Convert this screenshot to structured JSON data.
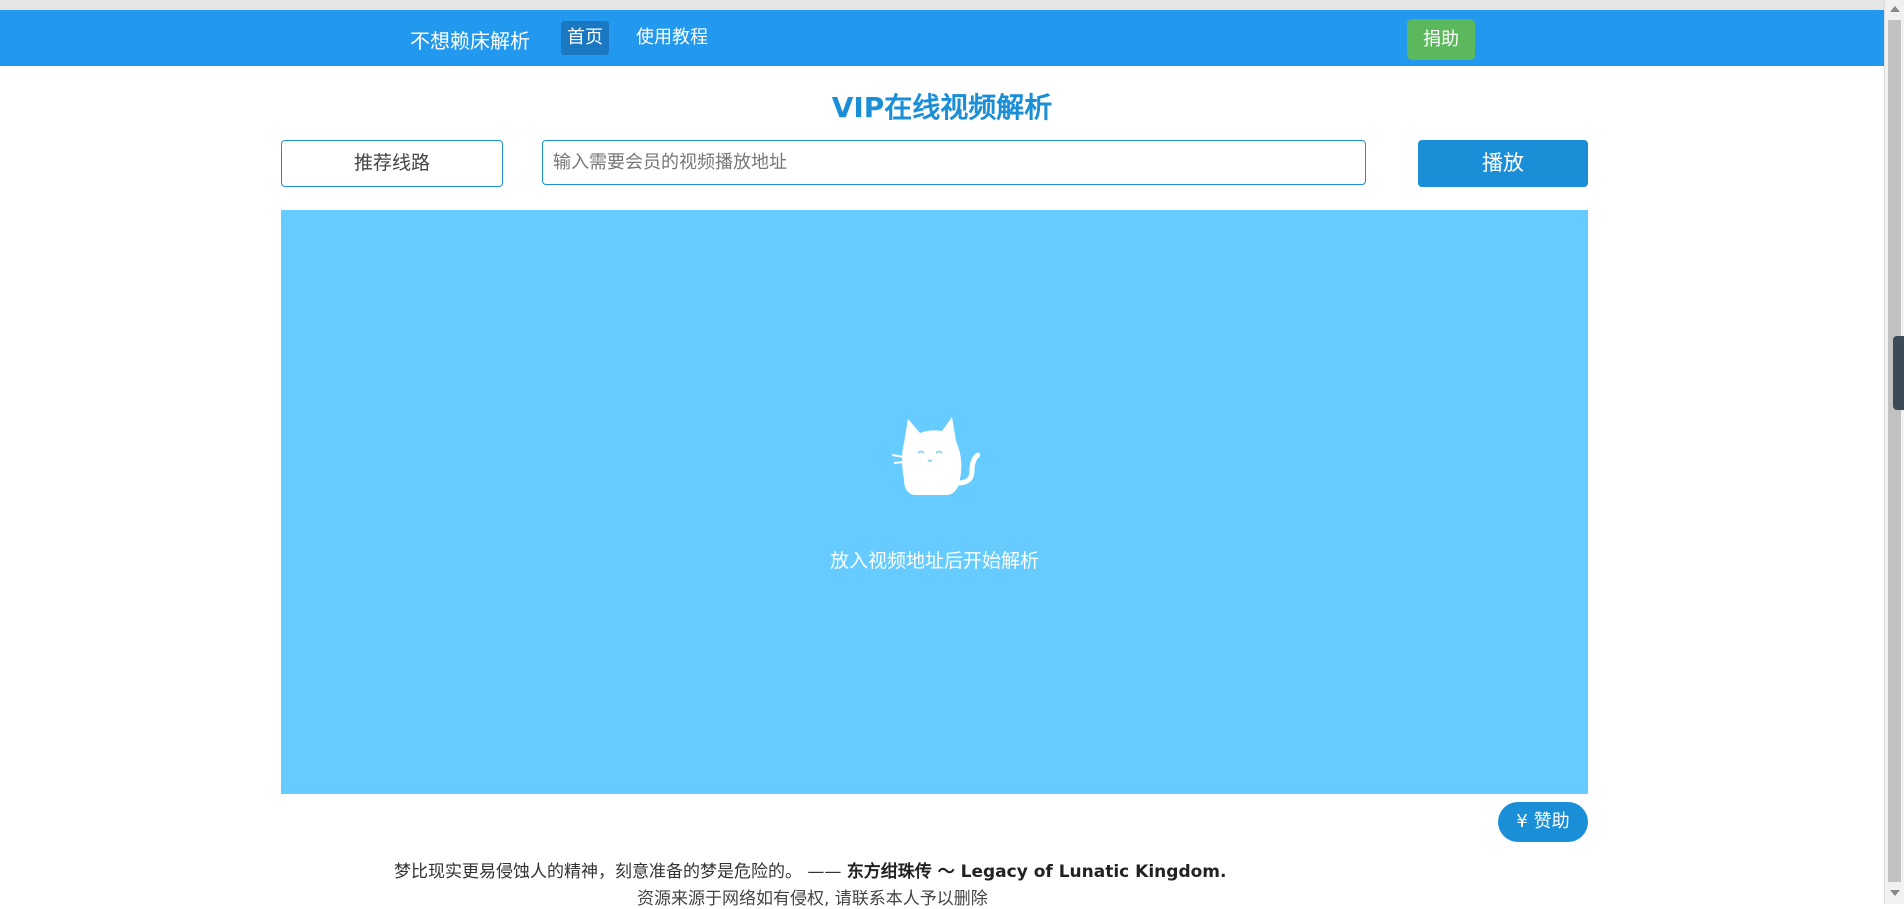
{
  "nav": {
    "brand": "不想赖床解析",
    "home": "首页",
    "tutorial": "使用教程",
    "donate": "捐助"
  },
  "main": {
    "title": "VIP在线视频解析",
    "route_button": "推荐线路",
    "url_placeholder": "输入需要会员的视频播放地址",
    "play_button": "播放",
    "player_hint": "放入视频地址后开始解析",
    "sponsor_button": "¥ 赞助"
  },
  "footer": {
    "quote_text": "梦比现实更易侵蚀人的精神，刻意准备的梦是危险的。 —— ",
    "quote_source": "东方绀珠传 ～ Legacy of Lunatic Kingdom.",
    "disclaimer": "资源来源于网络如有侵权, 请联系本人予以删除"
  },
  "colors": {
    "navbar": "#2299ee",
    "accent": "#1a8fd8",
    "player_bg": "#66ccff",
    "donate": "#5cb85c"
  },
  "icons": [
    "cat-icon"
  ]
}
